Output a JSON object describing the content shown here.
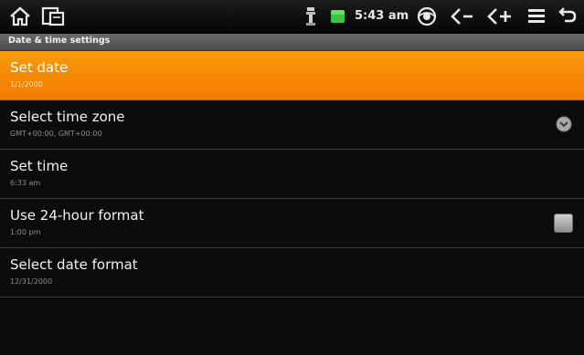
{
  "status_bar": {
    "icons_left": [
      "home-icon",
      "recent-apps-icon"
    ],
    "icons_right": [
      "usb-debug-icon",
      "battery-icon",
      "eye-icon",
      "volume-down-icon",
      "volume-up-icon",
      "menu-icon",
      "back-icon"
    ],
    "time": "5:43 am",
    "battery_color": "#3ec43e"
  },
  "title_bar": {
    "title": "Date & time settings"
  },
  "settings": {
    "items": [
      {
        "title": "Set date",
        "summary": "1/1/2000",
        "selected": true
      },
      {
        "title": "Select time zone",
        "summary": "GMT+00:00, GMT+00:00",
        "control": "chevron-icon"
      },
      {
        "title": "Set time",
        "summary": "6:33 am"
      },
      {
        "title": "Use 24-hour format",
        "summary": "1:00 pm",
        "control": "checkbox",
        "checked": false
      },
      {
        "title": "Select date format",
        "summary": "12/31/2000"
      }
    ]
  },
  "colors": {
    "accent": "#f7890a",
    "background": "#0c0c0c"
  }
}
